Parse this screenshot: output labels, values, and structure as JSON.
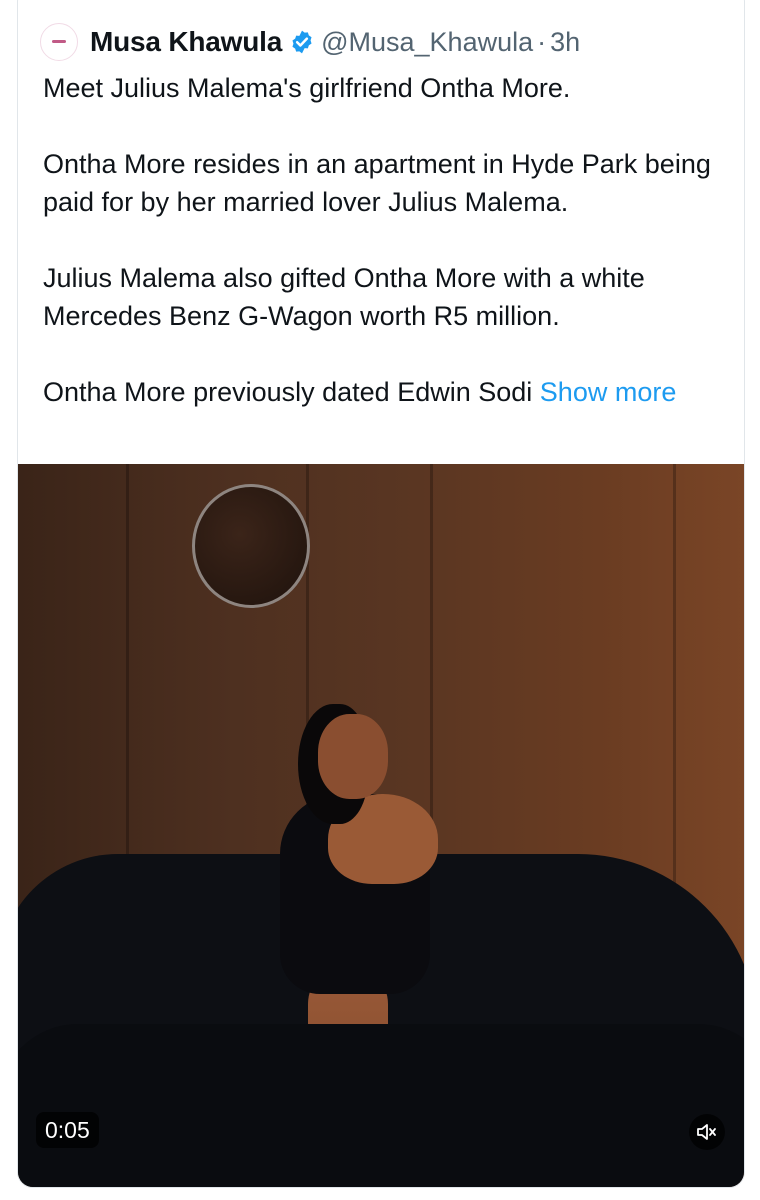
{
  "tweet": {
    "author_name": "Musa Khawula",
    "handle": "@Musa_Khawula",
    "separator": "·",
    "time": "3h",
    "paragraphs": [
      "Meet Julius Malema's girlfriend Ontha More.",
      "Ontha More resides in an apartment in Hyde Park being paid for by her married lover Julius Malema.",
      "Julius Malema also gifted Ontha More with a white Mercedes Benz G-Wagon worth R5 million.",
      "Ontha More previously dated Edwin Sodi"
    ],
    "show_more_label": "Show more"
  },
  "avatar": {
    "logo_text": "Musa Khawula"
  },
  "video": {
    "elapsed": "0:05",
    "mute_icon": "speaker-muted-icon"
  },
  "colors": {
    "accent": "#1d9bf0",
    "secondary_text": "#536471",
    "verified_badge": "#1d9bf0"
  }
}
